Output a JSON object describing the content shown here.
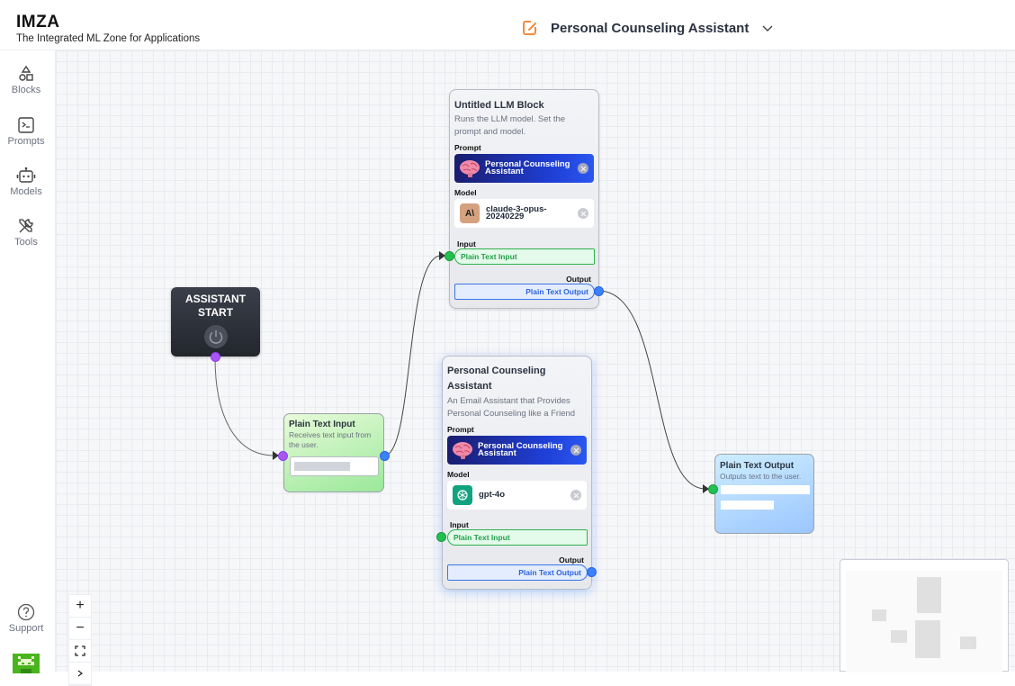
{
  "header": {
    "brand_title": "IMZA",
    "brand_subtitle": "The Integrated ML Zone for Applications",
    "project_title": "Personal Counseling Assistant",
    "project_icon": "edit-document-icon",
    "accent_color": "#f58a3c"
  },
  "sidebar": {
    "items": [
      {
        "label": "Blocks",
        "icon": "shapes-icon"
      },
      {
        "label": "Prompts",
        "icon": "terminal-icon"
      },
      {
        "label": "Models",
        "icon": "robot-icon"
      },
      {
        "label": "Tools",
        "icon": "tools-icon"
      }
    ],
    "support_label": "Support"
  },
  "canvas": {
    "start_node": {
      "title_line1": "ASSISTANT",
      "title_line2": "START"
    },
    "plain_text_input": {
      "title": "Plain Text Input",
      "description": "Receives text input from the user."
    },
    "llm_block_1": {
      "title": "Untitled LLM Block",
      "description": "Runs the LLM model. Set the prompt and model.",
      "prompt_label": "Prompt",
      "prompt_line1": "Personal Counseling",
      "prompt_line2": "Assistant",
      "model_label": "Model",
      "model_line1": "claude-3-opus-",
      "model_line2": "20240229",
      "input_label": "Input",
      "input_port": "Plain Text Input",
      "output_label": "Output",
      "output_port": "Plain Text Output"
    },
    "llm_block_2": {
      "title": "Personal Counseling Assistant",
      "description": "An Email Assistant that Provides Personal Counseling like a Friend",
      "prompt_label": "Prompt",
      "prompt_line1": "Personal Counseling",
      "prompt_line2": "Assistant",
      "model_label": "Model",
      "model_name": "gpt-4o",
      "input_label": "Input",
      "input_port": "Plain Text Input",
      "output_label": "Output",
      "output_port": "Plain Text Output"
    },
    "plain_text_output": {
      "title": "Plain Text Output",
      "description": "Outputs text to the user."
    }
  },
  "controls": {
    "zoom_in": "+",
    "zoom_out": "−"
  },
  "colors": {
    "input_port": "#22c04e",
    "output_port": "#3b82f6",
    "start_port": "#a855f7"
  }
}
